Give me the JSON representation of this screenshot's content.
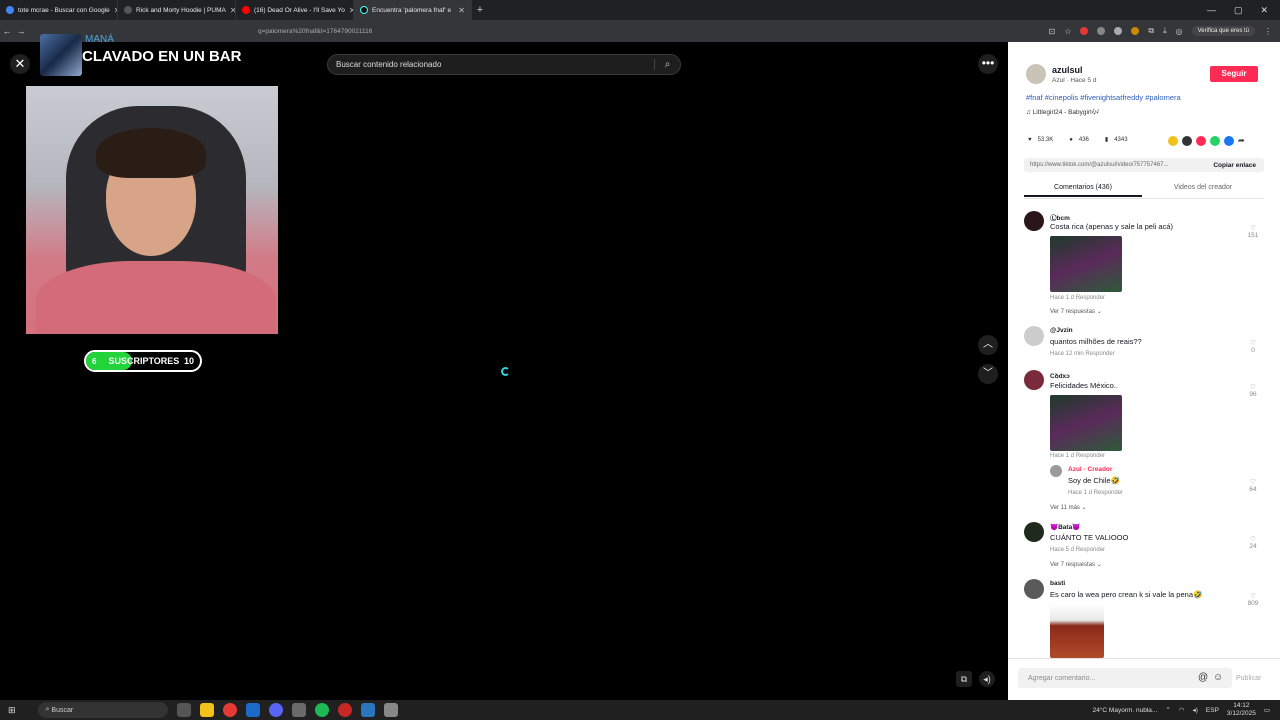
{
  "browser": {
    "tabs": [
      {
        "label": "tote mcrae - Buscar con Google",
        "color": "#4285f4"
      },
      {
        "label": "Rick and Morty Hoodie | PUMA",
        "color": "#333333"
      },
      {
        "label": "(16) Dead Or Alive - I'll Save Yo",
        "color": "#ff0000"
      },
      {
        "label": "Encuentra 'palomera fnaf' e",
        "color": "#111111"
      }
    ],
    "url_fragment": "q=palomera%20fnaf&t=1764790021116",
    "verify_label": "Verifica que eres tú"
  },
  "overlay": {
    "artist": "MANÁ",
    "song": "CLAVADO EN UN BAR",
    "subs_start": "6",
    "subs_label": "SUSCRIPTORES",
    "subs_goal": "10",
    "subs_progress": 0.4
  },
  "video": {
    "search_placeholder": "Buscar contenido relacionado",
    "close_icon": "close-icon",
    "more_icon": "more-icon"
  },
  "panel": {
    "username": "azulsul",
    "sub": "Azul · Hace 5 d",
    "follow_label": "Seguir",
    "tags": "#fnaf #cinepolis #fivenightsatfreddy #palomera",
    "music": "♫  Littlegirl24 - Babygirl🎶",
    "likes": "53.3K",
    "comments": "436",
    "saves": "4343",
    "link": "https://www.tiktok.com/@azulsul/video/757757467...",
    "copy_label": "Copiar enlace",
    "tab_comments": "Comentarios (436)",
    "tab_videos": "Videos del creador",
    "comment_list": [
      {
        "name": "Ⓛbcm",
        "text": "Costa rica (apenas y sale la peli acá)",
        "meta_time": "Hace 1 d",
        "meta_reply": "Responder",
        "likes": "151",
        "replies": "Ver 7 respuestas ⌄"
      },
      {
        "name": "@Jvzin",
        "text": "quantos milhões de reais??",
        "meta_time": "Hace 12 min",
        "meta_reply": "Responder",
        "likes": "0"
      },
      {
        "name": "Cꝺdxɔ",
        "text": "Felicidades México..",
        "meta_time": "Hace 1 d",
        "meta_reply": "Responder",
        "likes": "96",
        "replies": "Ver 11 más ⌄"
      },
      {
        "name": "Azul · Creador",
        "text": "Soy de Chile🤣",
        "meta_time": "Hace 1 d",
        "meta_reply": "Responder",
        "likes": "64"
      },
      {
        "name": "😈Bata😈",
        "text": "CUÁNTO TE VALIOOO",
        "meta_time": "Hace 5 d",
        "meta_reply": "Responder",
        "likes": "24",
        "replies": "Ver 7 respuestas ⌄"
      },
      {
        "name": "basti",
        "text": "Es caro la wea pero crean k si vale la pena🤣",
        "likes": "809"
      }
    ],
    "add_comment": "Agregar comentario...",
    "publish": "Publicar"
  },
  "taskbar": {
    "search": "Buscar",
    "weather": "24°C  Mayorm. nubla...",
    "lang": "ESP",
    "time": "14:12",
    "date": "3/12/2025"
  }
}
